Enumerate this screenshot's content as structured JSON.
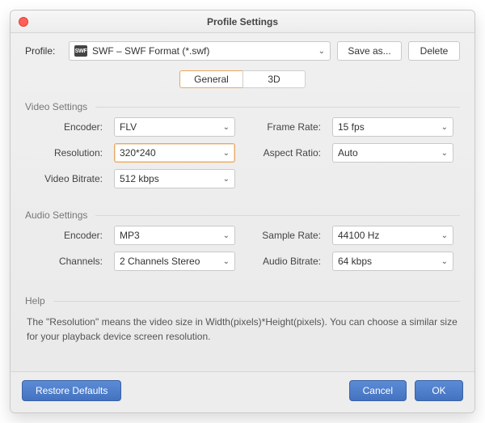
{
  "window": {
    "title": "Profile Settings"
  },
  "profile": {
    "label": "Profile:",
    "selected": "SWF – SWF Format (*.swf)",
    "icon_text": "SWF"
  },
  "buttons": {
    "save_as": "Save as...",
    "delete": "Delete",
    "restore_defaults": "Restore Defaults",
    "cancel": "Cancel",
    "ok": "OK"
  },
  "tabs": {
    "general": "General",
    "three_d": "3D"
  },
  "groups": {
    "video": "Video Settings",
    "audio": "Audio Settings",
    "help": "Help"
  },
  "video": {
    "encoder_label": "Encoder:",
    "encoder_value": "FLV",
    "frame_rate_label": "Frame Rate:",
    "frame_rate_value": "15 fps",
    "resolution_label": "Resolution:",
    "resolution_value": "320*240",
    "aspect_ratio_label": "Aspect Ratio:",
    "aspect_ratio_value": "Auto",
    "video_bitrate_label": "Video Bitrate:",
    "video_bitrate_value": "512 kbps"
  },
  "audio": {
    "encoder_label": "Encoder:",
    "encoder_value": "MP3",
    "sample_rate_label": "Sample Rate:",
    "sample_rate_value": "44100 Hz",
    "channels_label": "Channels:",
    "channels_value": "2 Channels Stereo",
    "audio_bitrate_label": "Audio Bitrate:",
    "audio_bitrate_value": "64 kbps"
  },
  "help_text": "The \"Resolution\" means the video size in Width(pixels)*Height(pixels).  You can choose a similar size for your playback device screen resolution."
}
